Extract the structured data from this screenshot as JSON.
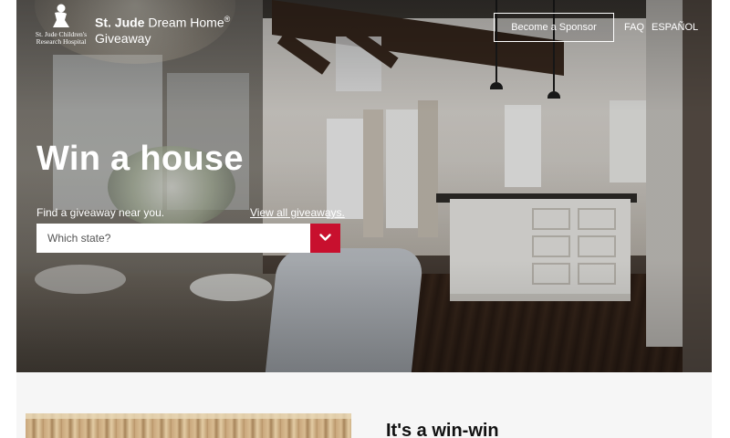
{
  "header": {
    "logo_line1": "St. Jude Children's",
    "logo_line2": "Research Hospital",
    "brand_bold": "St. Jude",
    "brand_regular": "Dream Home",
    "brand_mark": "®",
    "brand_line2": "Giveaway",
    "sponsor_button": "Become a Sponsor",
    "faq": "FAQ",
    "espanol": "ESPAÑOL"
  },
  "hero": {
    "title": "Win a house",
    "find_label": "Find a giveaway near you.",
    "view_all": "View all giveaways.",
    "state_placeholder": "Which state?"
  },
  "section": {
    "heading": "It's a win-win"
  },
  "colors": {
    "accent": "#c8102e",
    "white": "#ffffff",
    "section_bg": "#f6f6f6"
  },
  "icons": {
    "logo": "st-jude-child-figure-icon",
    "dropdown": "chevron-down-icon"
  }
}
